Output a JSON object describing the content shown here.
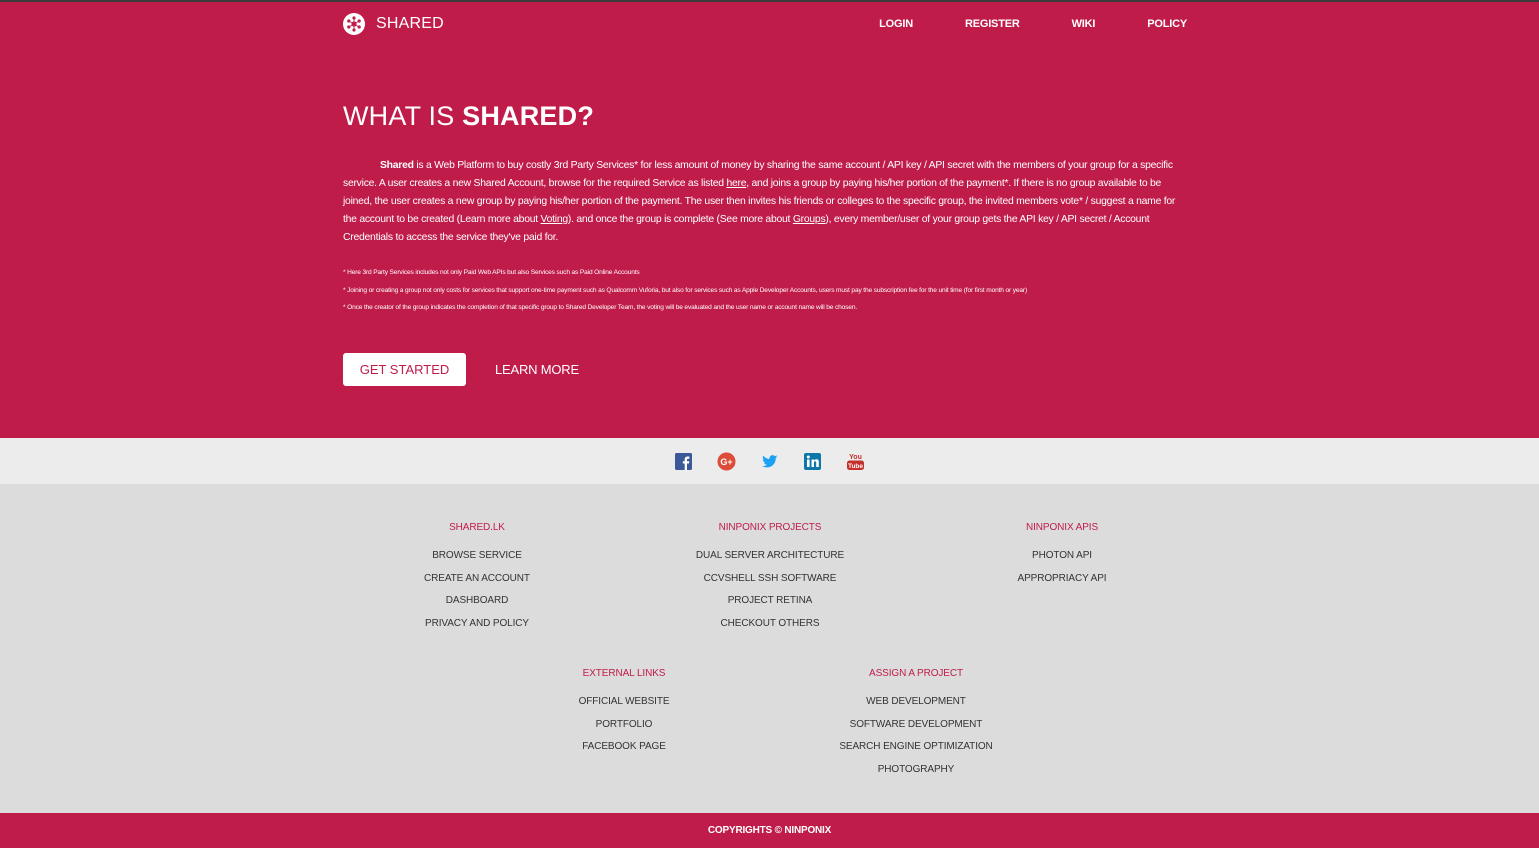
{
  "nav": {
    "brand": "SHARED",
    "links": [
      "LOGIN",
      "REGISTER",
      "WIKI",
      "POLICY"
    ]
  },
  "hero": {
    "title_prefix": "WHAT IS ",
    "title_bold": "SHARED?",
    "desc": {
      "bold_word": "Shared",
      "part1": " is a Web Platform to buy costly 3rd Party Services* for less amount of money by sharing the same account / API key / API secret with the members of your group for a specific service. A user creates a new Shared Account, browse for the required Service as listed ",
      "link1": "here",
      "part2": ", and joins a group by paying his/her portion of the payment*. If there is no group available to be joined, the user creates a new group by paying his/her portion of the payment. The user then invites his friends or colleges to the specific group, the invited members vote* / suggest a name for the account to be created (Learn more about ",
      "link2": "Voting",
      "part3": "). and once the group is complete (See more about ",
      "link3": "Groups",
      "part4": "), every member/user of your group gets the API key / API secret / Account Credentials to access the service they've paid for."
    },
    "notes": [
      "* Here 3rd Party Services includes not only Paid Web APIs but also Services such as Paid Online Accounts",
      "* Joining or creating a group not only costs for services that support one-time payment such as Qualcomm Vuforia, but also for services such as Apple Developer Accounts, users must pay the subscription fee for the unit time (for first month or year)",
      "* Once the creator of the group indicates the completion of that specific group to Shared Developer Team, the voting will be evaluated and the user name or account name will be chosen."
    ],
    "get_started": "GET STARTED",
    "learn_more": "LEARN MORE"
  },
  "social": [
    "facebook-icon",
    "google-plus-icon",
    "twitter-icon",
    "linkedin-icon",
    "youtube-icon"
  ],
  "footer": {
    "col1": {
      "title": "SHARED.LK",
      "items": [
        "BROWSE SERVICE",
        "CREATE AN ACCOUNT",
        "DASHBOARD",
        "PRIVACY AND POLICY"
      ]
    },
    "col2": {
      "title": "NINPONIX PROJECTS",
      "items": [
        "DUAL SERVER ARCHITECTURE",
        "CCVSHELL SSH SOFTWARE",
        "PROJECT RETINA",
        "CHECKOUT OTHERS"
      ]
    },
    "col3": {
      "title": "NINPONIX APIS",
      "items": [
        "PHOTON API",
        "APPROPRIACY API"
      ]
    },
    "col4": {
      "title": "EXTERNAL LINKS",
      "items": [
        "OFFICIAL WEBSITE",
        "PORTFOLIO",
        "FACEBOOK PAGE"
      ]
    },
    "col5": {
      "title": "ASSIGN A PROJECT",
      "items": [
        "WEB DEVELOPMENT",
        "SOFTWARE DEVELOPMENT",
        "SEARCH ENGINE OPTIMIZATION",
        "PHOTOGRAPHY"
      ]
    }
  },
  "copyright": "COPYRIGHTS © NINPONIX",
  "colors": {
    "brand": "#c01c4a",
    "social_bar": "#ececec",
    "footer_bg": "#dcdcdc"
  }
}
